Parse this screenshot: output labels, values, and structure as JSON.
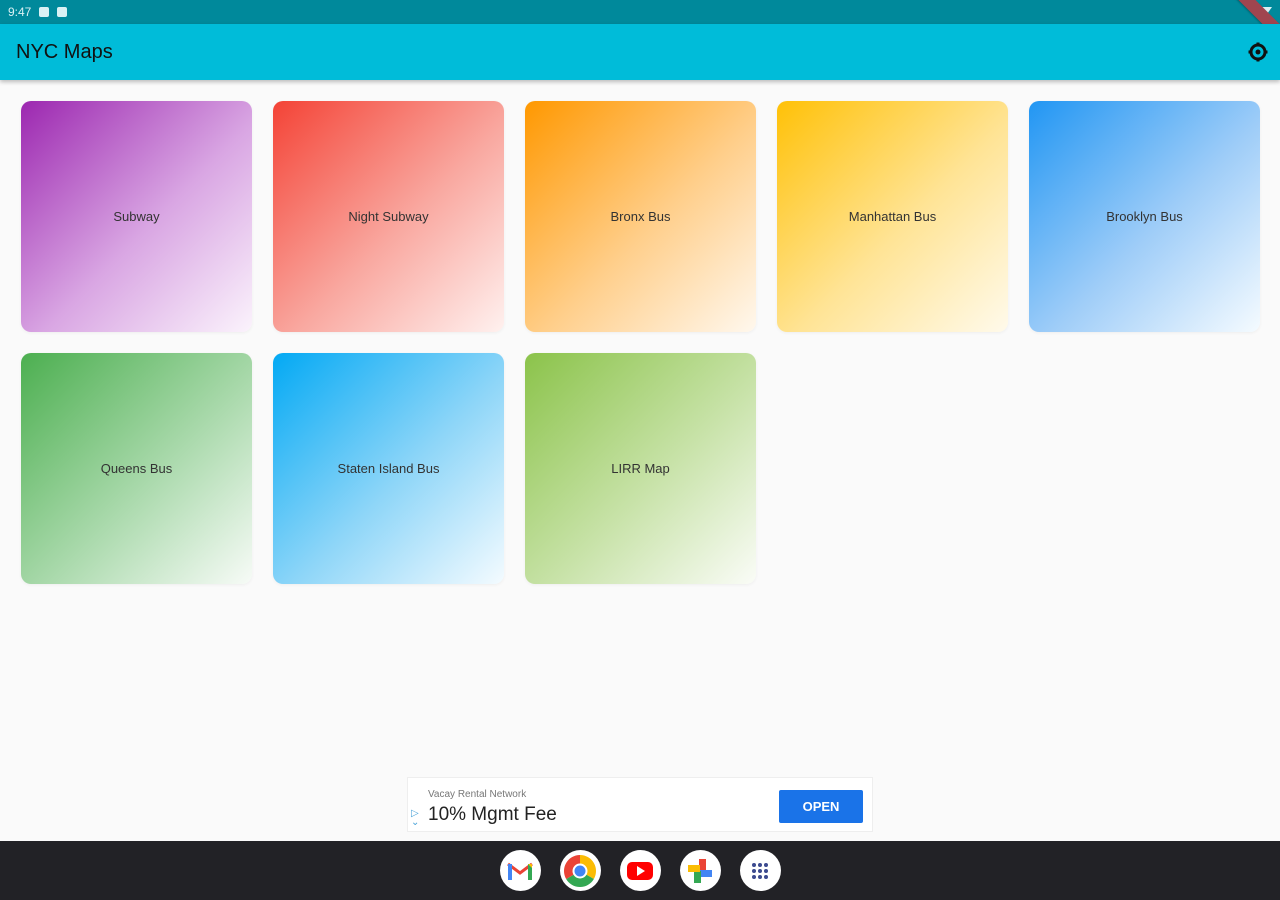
{
  "status_bar": {
    "time": "9:47"
  },
  "app_bar": {
    "title": "NYC Maps",
    "settings_icon": "settings-icon"
  },
  "tiles": [
    {
      "label": "Subway",
      "color": "#9c27b0"
    },
    {
      "label": "Night Subway",
      "color": "#f44336"
    },
    {
      "label": "Bronx Bus",
      "color": "#ff9800"
    },
    {
      "label": "Manhattan Bus",
      "color": "#ffc107"
    },
    {
      "label": "Brooklyn Bus",
      "color": "#2196f3"
    },
    {
      "label": "Queens Bus",
      "color": "#4caf50"
    },
    {
      "label": "Staten Island Bus",
      "color": "#03a9f4"
    },
    {
      "label": "LIRR Map",
      "color": "#8bc34a"
    }
  ],
  "ad": {
    "network": "Vacay Rental Network",
    "headline": "10% Mgmt Fee",
    "cta": "OPEN"
  },
  "dock": {
    "apps": [
      "gmail-icon",
      "chrome-icon",
      "youtube-icon",
      "photos-icon",
      "app-launcher-icon"
    ]
  },
  "colors": {
    "status_bar": "#00899b",
    "app_bar": "#00bcd9",
    "background": "#fafafa",
    "nav_bar": "#222226",
    "ad_button": "#1a73e8"
  }
}
